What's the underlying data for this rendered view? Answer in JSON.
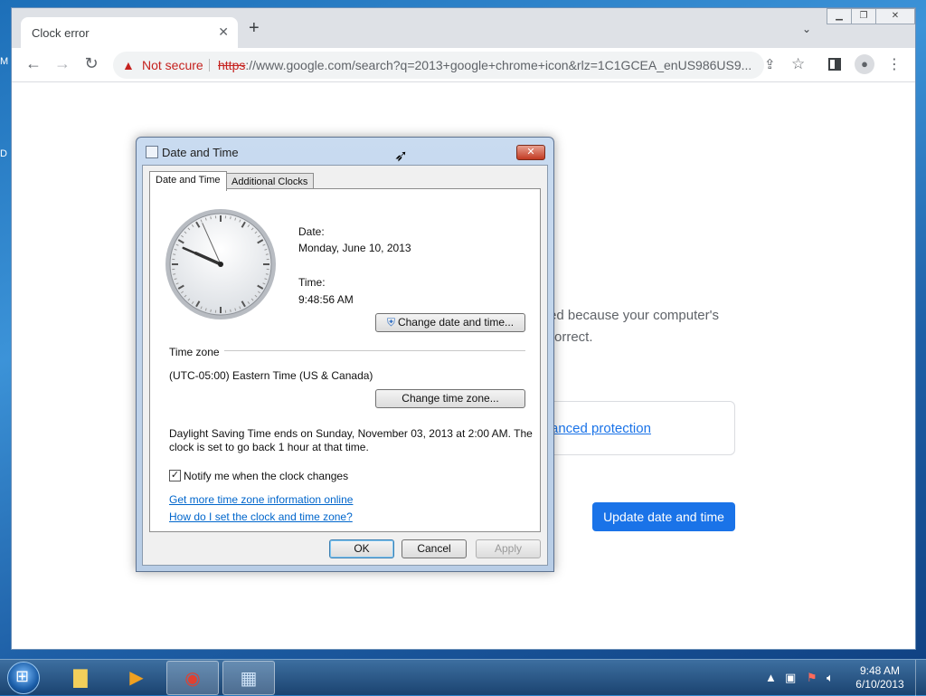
{
  "browser": {
    "tab_title": "Clock error",
    "new_tab": "+",
    "security_label": "Not secure",
    "url_scheme": "https",
    "url_rest": "://www.google.com/search?q=2013+google+chrome+icon&rlz=1C1GCEA_enUS986US9..."
  },
  "error_page": {
    "line1": "ed because your computer's",
    "line2": "orrect.",
    "advanced_link": "anced protection",
    "update_button": "Update date and time"
  },
  "dialog": {
    "title": "Date and Time",
    "tabs": [
      "Date and Time",
      "Additional Clocks"
    ],
    "date_label": "Date:",
    "date_value": "Monday, June 10, 2013",
    "time_label": "Time:",
    "time_value": "9:48:56 AM",
    "change_datetime_button": "Change date and time...",
    "timezone_heading": "Time zone",
    "timezone_value": "(UTC-05:00) Eastern Time (US & Canada)",
    "change_timezone_button": "Change time zone...",
    "dst_line1": "Daylight Saving Time ends on Sunday, November 03, 2013 at 2:00 AM. The",
    "dst_line2": "clock is set to go back 1 hour at that time.",
    "notify_label": "Notify me when the clock changes",
    "notify_checked": true,
    "link_more_info": "Get more time zone information online",
    "link_how_set": "How do I set the clock and time zone?",
    "ok_button": "OK",
    "cancel_button": "Cancel",
    "apply_button": "Apply"
  },
  "taskbar": {
    "time": "9:48 AM",
    "date": "6/10/2013"
  },
  "clock": {
    "hours": 9,
    "minutes": 48,
    "seconds": 56
  }
}
